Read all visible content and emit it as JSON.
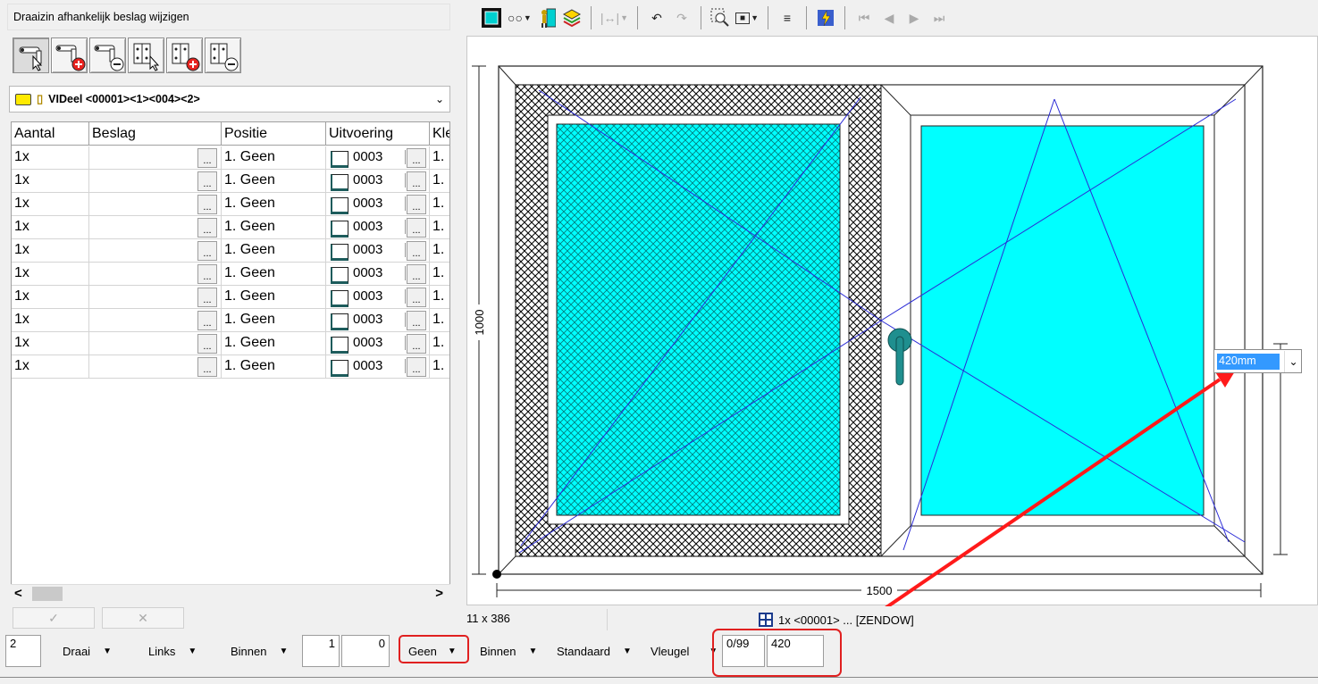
{
  "panel": {
    "title": "Draaizin afhankelijk beslag wijzigen",
    "tool_buttons": [
      "select-handle",
      "add-handle",
      "remove-handle",
      "select-hinge",
      "add-hinge",
      "remove-hinge"
    ],
    "part_select": "VIDeel <00001><1><004><2>"
  },
  "grid": {
    "columns": [
      "Aantal",
      "Beslag",
      "Positie",
      "Uitvoering",
      "Kle"
    ],
    "rows": [
      {
        "aantal": "1x",
        "beslag": "",
        "positie": "1. Geen",
        "uitvoering": "0003",
        "kleur": "1."
      },
      {
        "aantal": "1x",
        "beslag": "",
        "positie": "1. Geen",
        "uitvoering": "0003",
        "kleur": "1."
      },
      {
        "aantal": "1x",
        "beslag": "",
        "positie": "1. Geen",
        "uitvoering": "0003",
        "kleur": "1."
      },
      {
        "aantal": "1x",
        "beslag": "",
        "positie": "1. Geen",
        "uitvoering": "0003",
        "kleur": "1."
      },
      {
        "aantal": "1x",
        "beslag": "",
        "positie": "1. Geen",
        "uitvoering": "0003",
        "kleur": "1."
      },
      {
        "aantal": "1x",
        "beslag": "",
        "positie": "1. Geen",
        "uitvoering": "0003",
        "kleur": "1."
      },
      {
        "aantal": "1x",
        "beslag": "",
        "positie": "1. Geen",
        "uitvoering": "0003",
        "kleur": "1."
      },
      {
        "aantal": "1x",
        "beslag": "",
        "positie": "1. Geen",
        "uitvoering": "0003",
        "kleur": "1."
      },
      {
        "aantal": "1x",
        "beslag": "",
        "positie": "1. Geen",
        "uitvoering": "0003",
        "kleur": "1."
      },
      {
        "aantal": "1x",
        "beslag": "",
        "positie": "1. Geen",
        "uitvoering": "0003",
        "kleur": "1."
      }
    ],
    "dots_label": "...",
    "scroll_left": "<",
    "scroll_right": ">"
  },
  "left_buttons": {
    "confirm": "✓",
    "cancel": "✕"
  },
  "drawing": {
    "width_label": "1500",
    "height_label": "1000",
    "dimension_value": "420mm",
    "glass_color": "#00ffff",
    "line_color": "#2b2bd6",
    "arrow_color": "#ff1a1a"
  },
  "status": {
    "size": "11 x 386",
    "element": "1x <00001> ... [ZENDOW]"
  },
  "bottom": {
    "number": "2",
    "draai": "Draai",
    "links": "Links",
    "binnen1": "Binnen",
    "field1": "1",
    "field2": "0",
    "geen": "Geen",
    "binnen2": "Binnen",
    "standaard": "Standaard",
    "vleugel": "Vleugel",
    "range": "0/99",
    "value": "420"
  }
}
